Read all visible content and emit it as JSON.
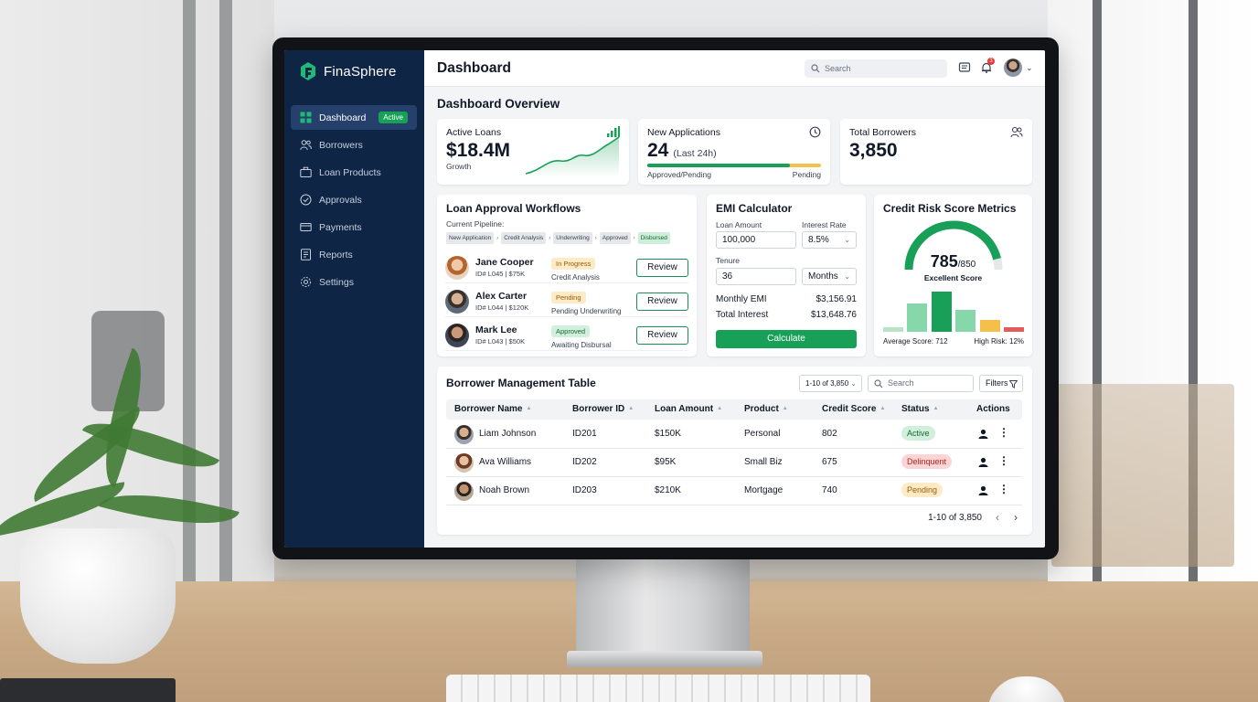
{
  "brand": {
    "name": "FinaSphere"
  },
  "sidebar": {
    "items": [
      {
        "label": "Dashboard",
        "icon": "grid-icon",
        "active": true,
        "badge": "Active"
      },
      {
        "label": "Borrowers",
        "icon": "users-icon"
      },
      {
        "label": "Loan Products",
        "icon": "briefcase-icon"
      },
      {
        "label": "Approvals",
        "icon": "check-circle-icon"
      },
      {
        "label": "Payments",
        "icon": "credit-card-icon"
      },
      {
        "label": "Reports",
        "icon": "report-icon"
      },
      {
        "label": "Settings",
        "icon": "gear-icon"
      }
    ]
  },
  "header": {
    "title": "Dashboard",
    "search_placeholder": "Search",
    "notification_count": "3"
  },
  "overview": {
    "title": "Dashboard Overview",
    "active_loans": {
      "label": "Active Loans",
      "value": "$18.4M",
      "sub": "Growth"
    },
    "new_applications": {
      "label": "New Applications",
      "value": "24",
      "period": "(Last 24h)",
      "legend_left": "Approved/Pending",
      "legend_right": "Pending",
      "approved_fraction": 0.82
    },
    "total_borrowers": {
      "label": "Total Borrowers",
      "value": "3,850"
    }
  },
  "workflow": {
    "title": "Loan Approval Workflows",
    "pipeline_label": "Current Pipeline:",
    "pipeline": [
      "New Application",
      "Credit Analysis",
      "Underwriting",
      "Approved",
      "Disbursed"
    ],
    "rows": [
      {
        "name": "Jane Cooper",
        "meta": "ID# L045 | $75K",
        "status": "In Progress",
        "step": "Credit Analysis",
        "action": "Review",
        "status_bg": "#fdebc8",
        "status_fg": "#9a5b00"
      },
      {
        "name": "Alex Carter",
        "meta": "ID# L044 | $120K",
        "status": "Pending",
        "step": "Pending Underwriting",
        "action": "Review",
        "status_bg": "#fdebc8",
        "status_fg": "#9a5b00"
      },
      {
        "name": "Mark Lee",
        "meta": "ID# L043 | $50K",
        "status": "Approved",
        "step": "Awaiting Disbursal",
        "action": "Review",
        "status_bg": "#d1f0dc",
        "status_fg": "#166534"
      }
    ]
  },
  "emi": {
    "title": "EMI Calculator",
    "loan_amount_label": "Loan Amount",
    "loan_amount": "100,000",
    "interest_label": "Interest Rate",
    "interest": "8.5%",
    "tenure_label": "Tenure",
    "tenure": "36",
    "tenure_unit": "Months",
    "monthly_emi_label": "Monthly EMI",
    "monthly_emi": "$3,156.91",
    "total_interest_label": "Total Interest",
    "total_interest": "$13,648.76",
    "button": "Calculate"
  },
  "credit_risk": {
    "title": "Credit Risk Score Metrics",
    "score": "785",
    "score_max": "/850",
    "score_label": "Excellent Score",
    "score_fraction": 0.923,
    "average_score": "Average Score: 712",
    "high_risk": "High Risk: 12%",
    "bars": [
      {
        "value": 0.12,
        "color": "#b7e4c7"
      },
      {
        "value": 0.7,
        "color": "#86d7aa"
      },
      {
        "value": 1.0,
        "color": "#18a058"
      },
      {
        "value": 0.55,
        "color": "#86d7aa"
      },
      {
        "value": 0.3,
        "color": "#f5c04a"
      },
      {
        "value": 0.12,
        "color": "#e25c5c"
      }
    ]
  },
  "table": {
    "title": "Borrower Management Table",
    "pager_select": "1-10 of 3,850",
    "search_placeholder": "Search",
    "filters": "Filters",
    "columns": [
      "Borrower Name",
      "Borrower ID",
      "Loan Amount",
      "Product",
      "Credit Score",
      "Status",
      "Actions"
    ],
    "rows": [
      {
        "name": "Liam Johnson",
        "id": "ID201",
        "amount": "$150K",
        "product": "Personal",
        "score": "802",
        "status": "Active",
        "status_bg": "#d1f0dc",
        "status_fg": "#166534"
      },
      {
        "name": "Ava Williams",
        "id": "ID202",
        "amount": "$95K",
        "product": "Small Biz",
        "score": "675",
        "status": "Delinquent",
        "status_bg": "#fbd5d5",
        "status_fg": "#b42318"
      },
      {
        "name": "Noah Brown",
        "id": "ID203",
        "amount": "$210K",
        "product": "Mortgage",
        "score": "740",
        "status": "Pending",
        "status_bg": "#fdebc8",
        "status_fg": "#9a5b00"
      }
    ],
    "pagination": "1-10 of 3,850"
  },
  "colors": {
    "sidebar": "#0f2545",
    "accent": "#18a058",
    "warning": "#f5c04a",
    "danger": "#e25c5c"
  }
}
